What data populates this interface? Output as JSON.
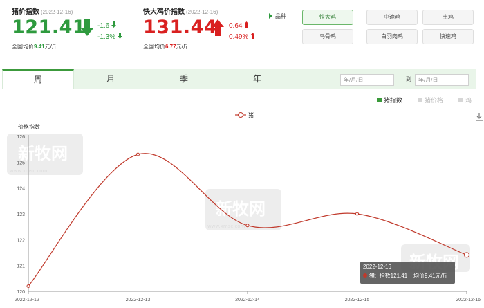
{
  "pig_panel": {
    "title": "猪价指数",
    "date": "(2022-12-16)",
    "value": "121.41",
    "change_abs": "-1.6",
    "change_pct": "-1.3%",
    "avg_label": "全国均价",
    "avg_value": "9.41",
    "avg_unit": "元/斤"
  },
  "chicken_panel": {
    "title": "快大鸡价指数",
    "date": "(2022-12-16)",
    "value": "131.44",
    "change_abs": "0.64",
    "change_pct": "0.49%",
    "avg_label": "全国均价",
    "avg_value": "6.77",
    "avg_unit": "元/斤"
  },
  "variety": {
    "label": "品种",
    "options": [
      "快大鸡",
      "中速鸡",
      "土鸡",
      "乌骨鸡",
      "白羽肉鸡",
      "快速鸡"
    ],
    "selected": "快大鸡"
  },
  "tabs": {
    "items": [
      "周",
      "月",
      "季",
      "年"
    ],
    "active": "周",
    "date_placeholder": "年/月/日",
    "to_label": "到"
  },
  "series_toggle": {
    "items": [
      {
        "label": "猪指数",
        "color": "#3a9a3a",
        "active": true
      },
      {
        "label": "猪价格",
        "color": "#cccccc",
        "active": false
      },
      {
        "label": "鸡",
        "color": "#cccccc",
        "active": false
      }
    ]
  },
  "watermark": {
    "text": "新牧网",
    "subtext": "www.xmsc.com"
  },
  "colors": {
    "up": "#d92020",
    "down": "#2e9a3e",
    "line": "#c0392b",
    "accent": "#3c9a3c"
  },
  "chart_data": {
    "type": "line",
    "ylabel": "价格指数",
    "legend": "猪",
    "x": [
      "2022-12-12",
      "2022-12-13",
      "2022-12-14",
      "2022-12-15",
      "2022-12-16"
    ],
    "series": [
      {
        "name": "猪",
        "values": [
          120.2,
          125.3,
          122.55,
          123.0,
          121.41
        ]
      }
    ],
    "ylim": [
      120,
      126
    ],
    "yticks": [
      120,
      121,
      122,
      123,
      124,
      125,
      126
    ],
    "grid": false,
    "legend_position": "top-center"
  },
  "tooltip": {
    "date": "2022-12-16",
    "series": "猪",
    "index_label": "指数",
    "index_value": "121.41",
    "avg_label": "均价",
    "avg_value": "9.41元/斤"
  }
}
